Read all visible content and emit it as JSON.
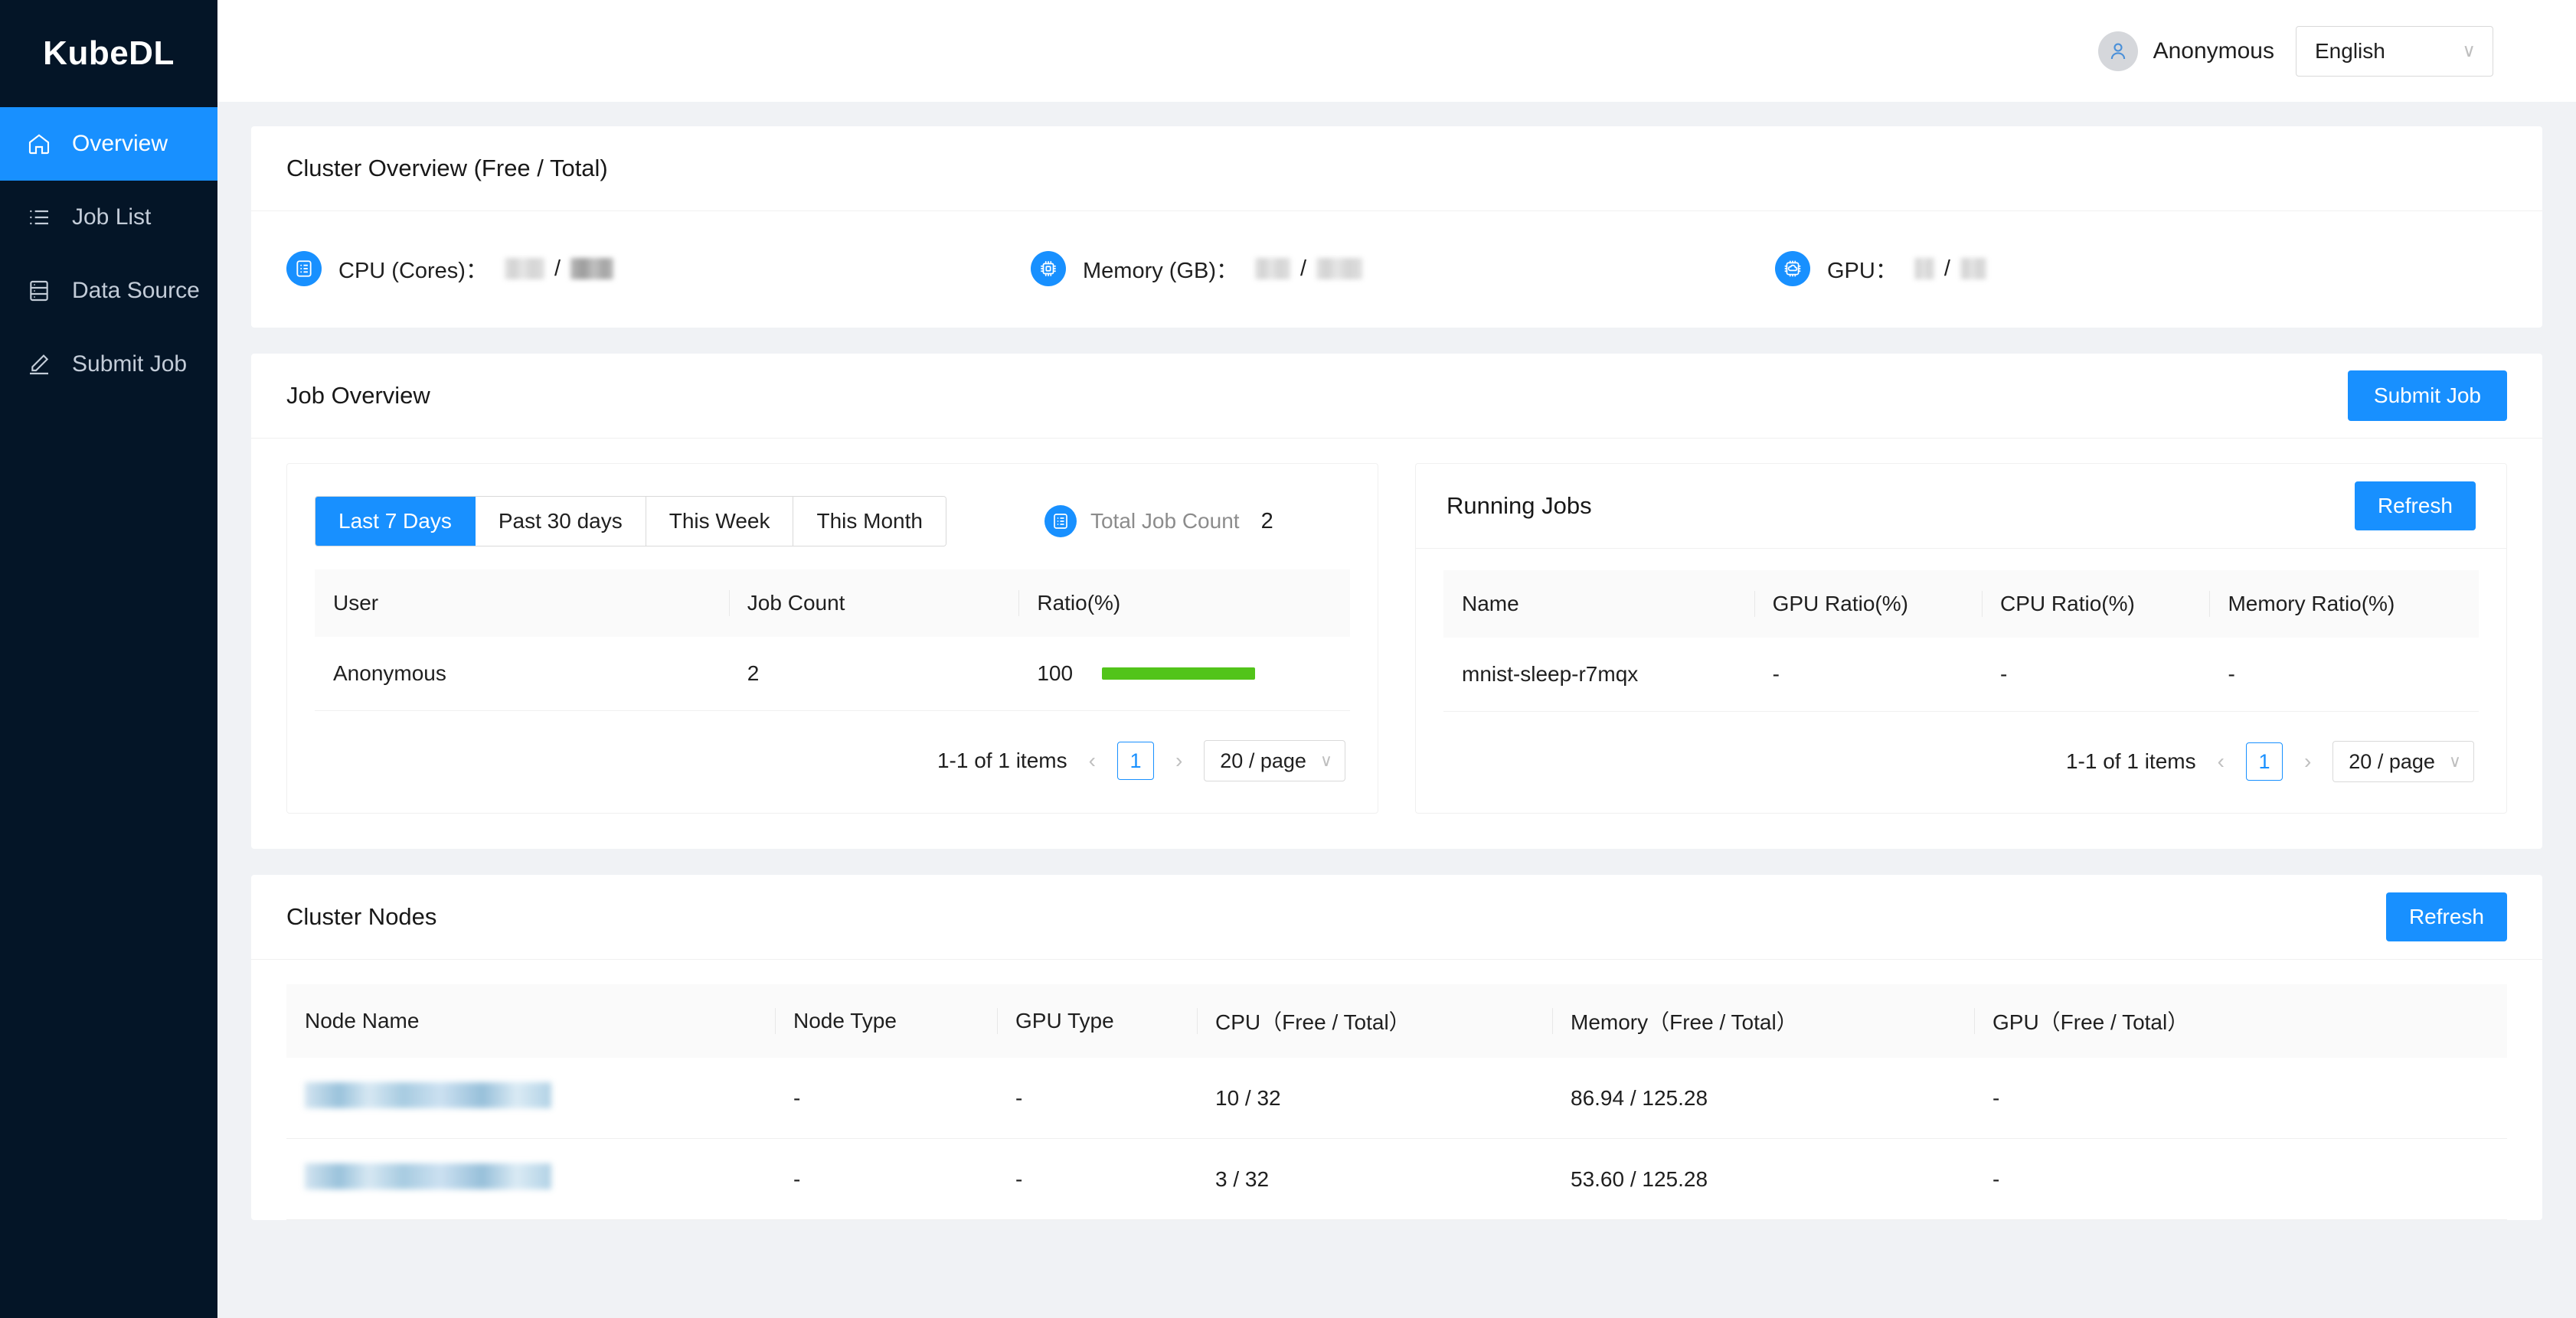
{
  "sidebar": {
    "brand": "KubeDL",
    "items": [
      {
        "label": "Overview",
        "icon": "home-icon",
        "active": true
      },
      {
        "label": "Job List",
        "icon": "list-icon",
        "active": false
      },
      {
        "label": "Data Source",
        "icon": "database-icon",
        "active": false
      },
      {
        "label": "Submit Job",
        "icon": "pencil-icon",
        "active": false
      }
    ]
  },
  "topbar": {
    "user_name": "Anonymous",
    "avatar_icon": "user-icon",
    "language": "English",
    "language_options": [
      "English"
    ],
    "chevron": "∨"
  },
  "cluster_overview": {
    "title": "Cluster Overview (Free / Total)",
    "stats": [
      {
        "label": "CPU (Cores)：",
        "icon": "cpu-list-icon",
        "free": "",
        "total": "",
        "redacted": true,
        "free_w": 52,
        "total_w": 56
      },
      {
        "label": "Memory (GB)：",
        "icon": "memory-chip-icon",
        "free": "",
        "total": "",
        "redacted": true,
        "free_w": 46,
        "total_w": 60
      },
      {
        "label": "GPU：",
        "icon": "gpu-chip-icon",
        "free": "",
        "total": "",
        "redacted": true,
        "free_w": 26,
        "total_w": 34
      }
    ],
    "separator": "/"
  },
  "job_overview": {
    "title": "Job Overview",
    "submit_button": "Submit Job",
    "range_tabs": [
      {
        "label": "Last 7 Days",
        "active": true
      },
      {
        "label": "Past 30 days",
        "active": false
      },
      {
        "label": "This Week",
        "active": false
      },
      {
        "label": "This Month",
        "active": false
      }
    ],
    "total_job_count_label": "Total Job Count",
    "total_job_count_value": "2",
    "total_icon": "job-count-icon",
    "user_table": {
      "columns": [
        "User",
        "Job Count",
        "Ratio(%)"
      ],
      "rows": [
        {
          "user": "Anonymous",
          "job_count": "2",
          "ratio": "100",
          "bar_percent": 100,
          "bar_color": "#52c41a"
        }
      ]
    },
    "user_pager": {
      "total_text": "1-1 of 1 items",
      "prev": "‹",
      "page": "1",
      "next": "›",
      "page_size": "20 / page",
      "chevron": "∨"
    }
  },
  "running_jobs": {
    "title": "Running Jobs",
    "refresh_button": "Refresh",
    "columns": [
      "Name",
      "GPU Ratio(%)",
      "CPU Ratio(%)",
      "Memory Ratio(%)"
    ],
    "rows": [
      {
        "name": "mnist-sleep-r7mqx",
        "gpu_ratio": "-",
        "cpu_ratio": "-",
        "memory_ratio": "-"
      }
    ],
    "pager": {
      "total_text": "1-1 of 1 items",
      "prev": "‹",
      "page": "1",
      "next": "›",
      "page_size": "20 / page",
      "chevron": "∨"
    }
  },
  "cluster_nodes": {
    "title": "Cluster Nodes",
    "refresh_button": "Refresh",
    "columns": [
      "Node Name",
      "Node Type",
      "GPU Type",
      "CPU（Free / Total）",
      "Memory（Free / Total）",
      "GPU（Free / Total）"
    ],
    "rows": [
      {
        "node_name": "",
        "node_name_redacted": true,
        "node_name_w": 322,
        "node_type": "-",
        "gpu_type": "-",
        "cpu": "10 / 32",
        "memory": "86.94 / 125.28",
        "gpu": "-"
      },
      {
        "node_name": "",
        "node_name_redacted": true,
        "node_name_w": 322,
        "node_type": "-",
        "gpu_type": "-",
        "cpu": "3 / 32",
        "memory": "53.60 / 125.28",
        "gpu": "-"
      }
    ]
  },
  "colors": {
    "sidebar_bg": "#041527",
    "accent": "#1890ff",
    "page_bg": "#f0f2f5",
    "card_bg": "#ffffff",
    "bar_green": "#52c41a",
    "border": "#f0f0f0"
  }
}
